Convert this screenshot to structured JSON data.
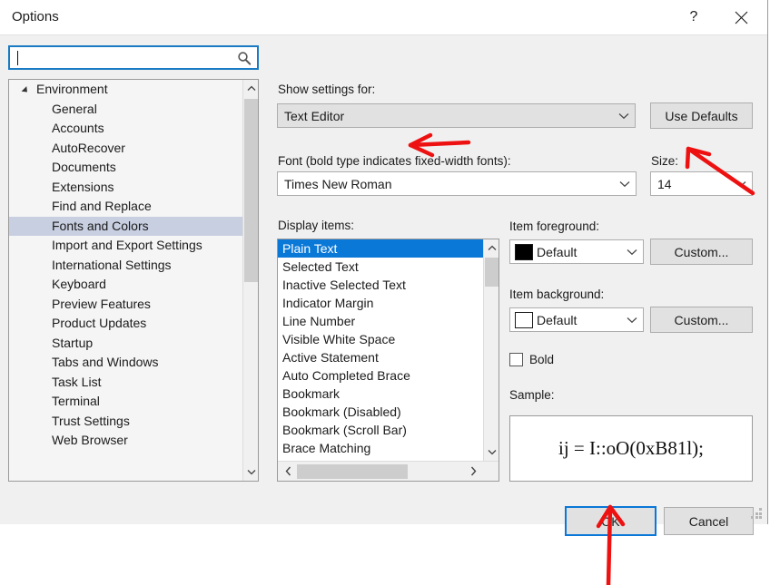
{
  "window": {
    "title": "Options",
    "help_icon": "question-mark-icon",
    "close_icon": "close-icon"
  },
  "search": {
    "value": "",
    "placeholder": "",
    "icon": "search-icon"
  },
  "tree": {
    "items": [
      {
        "label": "Environment",
        "level": 0,
        "expanded": true,
        "selected": false
      },
      {
        "label": "General",
        "level": 1,
        "selected": false
      },
      {
        "label": "Accounts",
        "level": 1,
        "selected": false
      },
      {
        "label": "AutoRecover",
        "level": 1,
        "selected": false
      },
      {
        "label": "Documents",
        "level": 1,
        "selected": false
      },
      {
        "label": "Extensions",
        "level": 1,
        "selected": false
      },
      {
        "label": "Find and Replace",
        "level": 1,
        "selected": false
      },
      {
        "label": "Fonts and Colors",
        "level": 1,
        "selected": true
      },
      {
        "label": "Import and Export Settings",
        "level": 1,
        "selected": false
      },
      {
        "label": "International Settings",
        "level": 1,
        "selected": false
      },
      {
        "label": "Keyboard",
        "level": 1,
        "selected": false
      },
      {
        "label": "Preview Features",
        "level": 1,
        "selected": false
      },
      {
        "label": "Product Updates",
        "level": 1,
        "selected": false
      },
      {
        "label": "Startup",
        "level": 1,
        "selected": false
      },
      {
        "label": "Tabs and Windows",
        "level": 1,
        "selected": false
      },
      {
        "label": "Task List",
        "level": 1,
        "selected": false
      },
      {
        "label": "Terminal",
        "level": 1,
        "selected": false
      },
      {
        "label": "Trust Settings",
        "level": 1,
        "selected": false
      },
      {
        "label": "Web Browser",
        "level": 1,
        "selected": false
      }
    ],
    "scroll_up_icon": "chevron-up-icon",
    "scroll_down_icon": "chevron-down-icon"
  },
  "show_settings": {
    "label": "Show settings for:",
    "value": "Text Editor",
    "chevron_icon": "chevron-down-icon"
  },
  "use_defaults": {
    "label": "Use Defaults"
  },
  "font": {
    "label": "Font (bold type indicates fixed-width fonts):",
    "value": "Times New Roman",
    "chevron_icon": "chevron-down-icon"
  },
  "size": {
    "label": "Size:",
    "value": "14",
    "chevron_icon": "chevron-down-icon"
  },
  "display_items": {
    "label": "Display items:",
    "selected_index": 0,
    "items": [
      "Plain Text",
      "Selected Text",
      "Inactive Selected Text",
      "Indicator Margin",
      "Line Number",
      "Visible White Space",
      "Active Statement",
      "Auto Completed Brace",
      "Bookmark",
      "Bookmark (Disabled)",
      "Bookmark (Scroll Bar)",
      "Brace Matching"
    ],
    "scroll_up_icon": "chevron-up-icon",
    "scroll_down_icon": "chevron-down-icon",
    "scroll_left_icon": "chevron-left-icon",
    "scroll_right_icon": "chevron-right-icon"
  },
  "item_foreground": {
    "label": "Item foreground:",
    "value": "Default",
    "swatch_color": "#000000",
    "chevron_icon": "chevron-down-icon",
    "custom_label": "Custom..."
  },
  "item_background": {
    "label": "Item background:",
    "value": "Default",
    "swatch_color": "#ffffff",
    "chevron_icon": "chevron-down-icon",
    "custom_label": "Custom..."
  },
  "bold": {
    "label": "Bold",
    "checked": false
  },
  "sample": {
    "label": "Sample:",
    "text": "ij = I::oO(0xB81l);"
  },
  "buttons": {
    "ok": "OK",
    "cancel": "Cancel"
  },
  "annotations": {
    "color": "#ee1111",
    "arrows": [
      {
        "name": "arrow-to-font-field",
        "target": "font-combo"
      },
      {
        "name": "arrow-to-size-field",
        "target": "size-combo"
      },
      {
        "name": "arrow-to-ok-button",
        "target": "ok-button"
      }
    ]
  },
  "resize_grip": "resize-grip-icon"
}
